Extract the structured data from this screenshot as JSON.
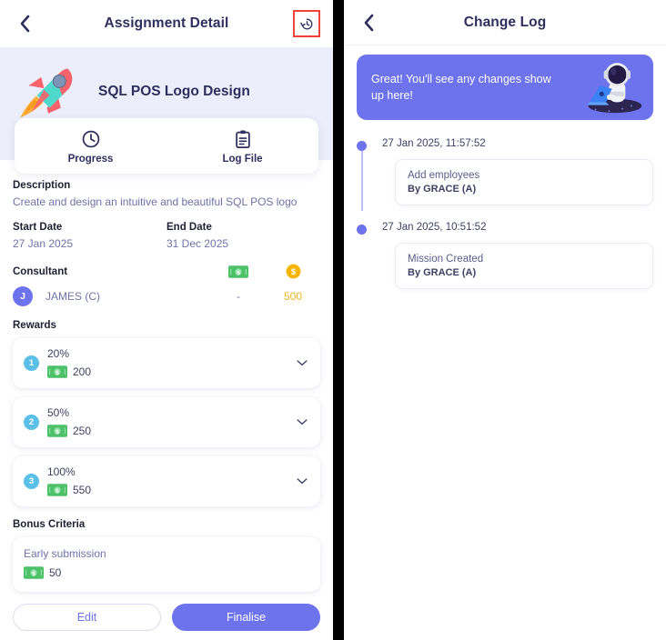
{
  "left": {
    "topbar": {
      "back_icon": "chevron-left-icon",
      "title": "Assignment Detail",
      "history_icon": "history-clock-icon"
    },
    "hero": {
      "illustration": "rocket-icon",
      "title": "SQL POS Logo Design"
    },
    "tabs": [
      {
        "label": "Progress",
        "icon": "clock-icon"
      },
      {
        "label": "Log File",
        "icon": "clipboard-icon"
      }
    ],
    "description": {
      "label": "Description",
      "value": "Create and design an intuitive and beautiful SQL POS logo"
    },
    "start_date": {
      "label": "Start Date",
      "value": "27 Jan 2025"
    },
    "end_date": {
      "label": "End Date",
      "value": "31 Dec 2025"
    },
    "consultant": {
      "label": "Consultant",
      "cash_icon": "banknote-icon",
      "coin_icon": "coin-icon",
      "avatar_initial": "J",
      "name": "JAMES (C)",
      "cash_value": "-",
      "coin_value": "500"
    },
    "rewards": {
      "label": "Rewards",
      "items": [
        {
          "num": "1",
          "percent": "20%",
          "amount": "200",
          "money_icon": "banknote-icon",
          "chevron": "chevron-down-icon"
        },
        {
          "num": "2",
          "percent": "50%",
          "amount": "250",
          "money_icon": "banknote-icon",
          "chevron": "chevron-down-icon"
        },
        {
          "num": "3",
          "percent": "100%",
          "amount": "550",
          "money_icon": "banknote-icon",
          "chevron": "chevron-down-icon"
        }
      ]
    },
    "bonus": {
      "label": "Bonus Criteria",
      "title": "Early submission",
      "amount": "50",
      "money_icon": "banknote-icon"
    },
    "footer": {
      "edit_label": "Edit",
      "finalise_label": "Finalise"
    }
  },
  "right": {
    "topbar": {
      "back_icon": "chevron-left-icon",
      "title": "Change Log"
    },
    "banner": {
      "text": "Great! You'll see any changes show up here!",
      "illustration": "astronaut-laptop-icon"
    },
    "timeline": [
      {
        "time": "27 Jan 2025, 11:57:52",
        "title": "Add employees",
        "by": "By GRACE (A)"
      },
      {
        "time": "27 Jan 2025, 10:51:52",
        "title": "Mission Created",
        "by": "By GRACE (A)"
      }
    ]
  },
  "colors": {
    "accent": "#6c73ed",
    "highlight": "#f04438",
    "hero_bg": "#eceefb",
    "money_green": "#4cc167",
    "coin_yellow": "#f7b500",
    "badge_blue": "#5bc0e8",
    "text_dark": "#2e2f5e"
  }
}
